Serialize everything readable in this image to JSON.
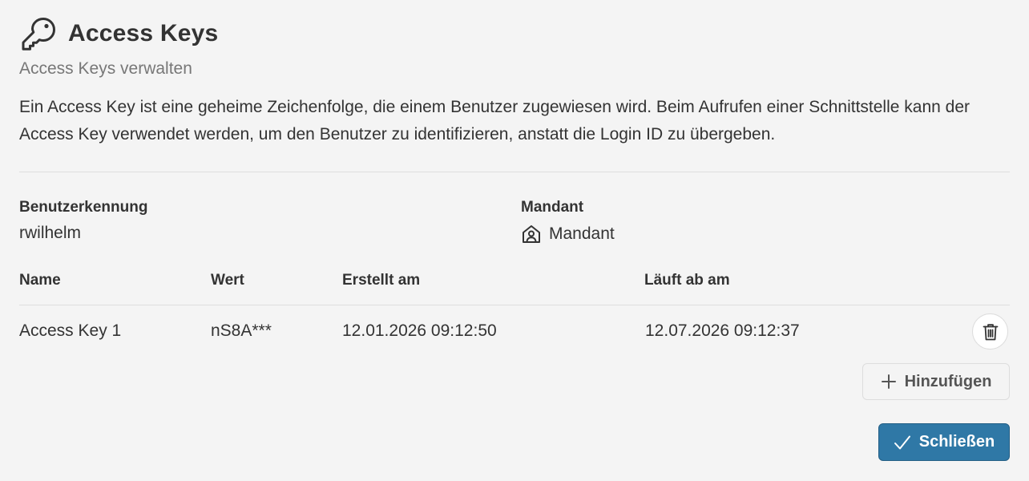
{
  "dialog": {
    "title": "Access Keys",
    "subtitle": "Access Keys verwalten",
    "description": "Ein Access Key ist eine geheime Zeichenfolge, die einem Benutzer zugewiesen wird. Beim Aufrufen einer Schnittstelle kann der Access Key verwendet werden, um den Benutzer zu identifizieren, anstatt die Login ID zu übergeben.",
    "title_icon": "key-icon"
  },
  "user": {
    "id_label": "Benutzerkennung",
    "id_value": "rwilhelm",
    "tenant_label": "Mandant",
    "tenant_value": "Mandant",
    "tenant_icon": "home-icon"
  },
  "table": {
    "columns": [
      "Name",
      "Wert",
      "Erstellt am",
      "Läuft ab am"
    ],
    "rows": [
      {
        "name": "Access Key 1",
        "value": "nS8A***",
        "created": "12.01.2026 09:12:50",
        "expires": "12.07.2026 09:12:37",
        "action_icon": "trash-icon"
      }
    ]
  },
  "actions": {
    "add_label": "Hinzufügen",
    "add_icon": "plus-icon",
    "close_label": "Schließen",
    "close_icon": "check-icon"
  },
  "colors": {
    "background": "#f4f4f4",
    "primary": "#2f78a6",
    "text": "#333333",
    "muted": "#777777",
    "border": "#dddddd"
  }
}
